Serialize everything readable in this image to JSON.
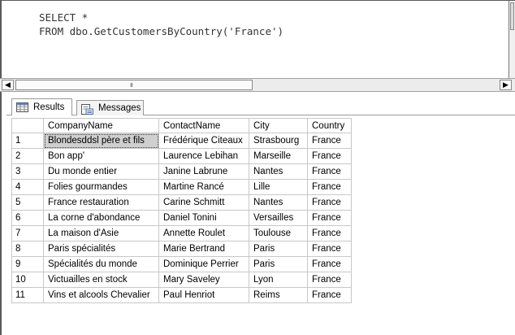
{
  "query": {
    "line1": "SELECT *",
    "line2": "FROM dbo.GetCustomersByCountry('France')"
  },
  "scrollbar": {
    "grip": "III",
    "left_arrow": "◀",
    "right_arrow": "▶"
  },
  "tabs": [
    {
      "label": "Results",
      "icon": "grid-icon"
    },
    {
      "label": "Messages",
      "icon": "message-icon"
    }
  ],
  "grid": {
    "columns": [
      "",
      "CompanyName",
      "ContactName",
      "City",
      "Country"
    ],
    "rows": [
      [
        "1",
        "Blondesddsl père et fils",
        "Frédérique Citeaux",
        "Strasbourg",
        "France"
      ],
      [
        "2",
        "Bon app'",
        "Laurence Lebihan",
        "Marseille",
        "France"
      ],
      [
        "3",
        "Du monde entier",
        "Janine Labrune",
        "Nantes",
        "France"
      ],
      [
        "4",
        "Folies gourmandes",
        "Martine Rancé",
        "Lille",
        "France"
      ],
      [
        "5",
        "France restauration",
        "Carine Schmitt",
        "Nantes",
        "France"
      ],
      [
        "6",
        "La corne d'abondance",
        "Daniel Tonini",
        "Versailles",
        "France"
      ],
      [
        "7",
        "La maison d'Asie",
        "Annette Roulet",
        "Toulouse",
        "France"
      ],
      [
        "8",
        "Paris spécialités",
        "Marie Bertrand",
        "Paris",
        "France"
      ],
      [
        "9",
        "Spécialités du monde",
        "Dominique Perrier",
        "Paris",
        "France"
      ],
      [
        "10",
        "Victuailles en stock",
        "Mary Saveley",
        "Lyon",
        "France"
      ],
      [
        "11",
        "Vins et alcools Chevalier",
        "Paul Henriot",
        "Reims",
        "France"
      ]
    ]
  }
}
